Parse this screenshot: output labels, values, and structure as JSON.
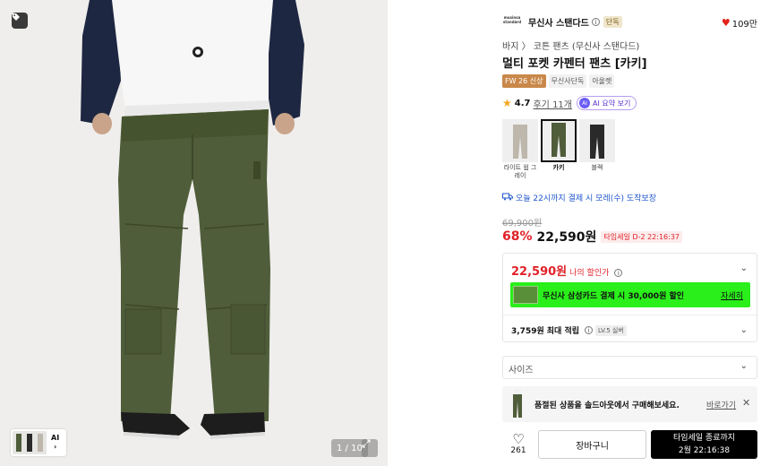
{
  "gallery": {
    "counter": "1 / 10",
    "thumb_ai_label": "AI",
    "thumb_ai_arrow": "›",
    "total_images": 10,
    "current_image": 1
  },
  "brand": {
    "logo_text": "musinsa standard",
    "name": "무신사 스탠다드",
    "info": "i",
    "exclusive": "단독",
    "likes": "109만"
  },
  "product": {
    "breadcrumb": "바지 〉 코튼 팬츠 (무신사 스탠다드)",
    "title": "멀티 포켓 카펜터 팬츠 [카키]",
    "badges": [
      "FW 26 신상",
      "무신사단독",
      "아울렛"
    ],
    "rating": "4.7",
    "review_link": "후기 11개",
    "ai_summary": "AI 요약 보기",
    "ai_icon": "AI"
  },
  "colors": [
    {
      "label": "라이트 웜 그레이",
      "selected": false,
      "color": "#bdb7ac"
    },
    {
      "label": "카키",
      "selected": true,
      "color": "#4f5d3a"
    },
    {
      "label": "블랙",
      "selected": false,
      "color": "#2a2a2a"
    }
  ],
  "delivery": {
    "text": "오늘 22시까지 결제 시 모레(수) 도착보장"
  },
  "price": {
    "original": "69,900원",
    "discount": "68%",
    "sale": "22,590원",
    "timesale": "타임세일 D-2 22:16:37"
  },
  "benefits": {
    "my_price": "22,590원",
    "my_price_label": "나의 할인가",
    "promo_text": "무신사 삼성카드 결제 시 30,000원 할인",
    "promo_more": "자세히",
    "points_amount": "3,759원",
    "points_label": "최대 적립",
    "level": "LV.5 실버"
  },
  "size": {
    "placeholder": "사이즈"
  },
  "soldout": {
    "message": "품절된 상품을 솔드아웃에서 구매해보세요.",
    "link": "바로가기",
    "close": "✕"
  },
  "actions": {
    "wish_count": "261",
    "cart": "장바구니",
    "buy_line1": "타임세일 종료까지",
    "buy_line2": "2월 22:16:38"
  },
  "colors_theme": {
    "sale_red": "#e0222a",
    "promo_green": "#2aef1b",
    "link_blue": "#1e56cc",
    "pants_khaki": "#4f5d3a"
  }
}
